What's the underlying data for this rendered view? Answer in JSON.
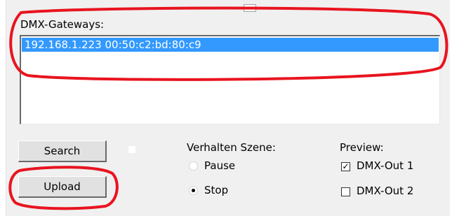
{
  "gateways": {
    "label": "DMX-Gateways:",
    "items": [
      {
        "text": "192.168.1.223 00:50:c2:bd:80:c9",
        "selected": true
      }
    ]
  },
  "buttons": {
    "search": "Search",
    "upload": "Upload"
  },
  "behavior": {
    "title": "Verhalten Szene:",
    "options": [
      {
        "label": "Pause",
        "selected": false
      },
      {
        "label": "Stop",
        "selected": true
      }
    ]
  },
  "preview": {
    "title": "Preview:",
    "outputs": [
      {
        "label": "DMX-Out 1",
        "checked": true
      },
      {
        "label": "DMX-Out 2",
        "checked": false
      }
    ]
  },
  "colors": {
    "selection": "#3399ff",
    "annotation_red": "#e8141f",
    "panel_bg": "#f0f0f0"
  },
  "icons": {
    "check": "check-mark-icon"
  }
}
